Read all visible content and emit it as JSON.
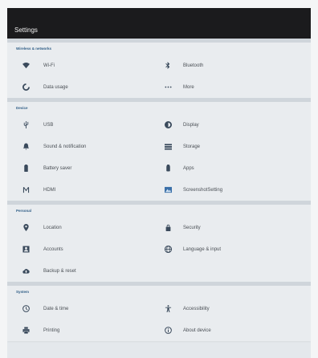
{
  "app": {
    "title": "Settings"
  },
  "colors": {
    "appbar": "#1b1b1d",
    "section_title": "#2f5d86",
    "icon": "#3a4a5c",
    "text": "#4a4f55"
  },
  "sections": [
    {
      "title": "Wireless & networks",
      "items": [
        {
          "label": "Wi-Fi",
          "icon": "wifi-icon"
        },
        {
          "label": "Bluetooth",
          "icon": "bluetooth-icon"
        },
        {
          "label": "Data usage",
          "icon": "data-usage-icon"
        },
        {
          "label": "More",
          "icon": "more-icon"
        }
      ]
    },
    {
      "title": "Device",
      "items": [
        {
          "label": "USB",
          "icon": "usb-icon"
        },
        {
          "label": "Display",
          "icon": "display-icon"
        },
        {
          "label": "Sound & notification",
          "icon": "bell-icon"
        },
        {
          "label": "Storage",
          "icon": "storage-icon"
        },
        {
          "label": "Battery saver",
          "icon": "battery-icon"
        },
        {
          "label": "Apps",
          "icon": "apps-icon"
        },
        {
          "label": "HDMI",
          "icon": "hdmi-icon"
        },
        {
          "label": "ScreenshotSetting",
          "icon": "screenshot-icon"
        }
      ]
    },
    {
      "title": "Personal",
      "items": [
        {
          "label": "Location",
          "icon": "location-icon"
        },
        {
          "label": "Security",
          "icon": "lock-icon"
        },
        {
          "label": "Accounts",
          "icon": "accounts-icon"
        },
        {
          "label": "Language & input",
          "icon": "globe-icon"
        },
        {
          "label": "Backup & reset",
          "icon": "cloud-icon"
        }
      ]
    },
    {
      "title": "System",
      "items": [
        {
          "label": "Date & time",
          "icon": "clock-icon"
        },
        {
          "label": "Accessibility",
          "icon": "accessibility-icon"
        },
        {
          "label": "Printing",
          "icon": "printer-icon"
        },
        {
          "label": "About device",
          "icon": "info-icon"
        }
      ]
    }
  ]
}
